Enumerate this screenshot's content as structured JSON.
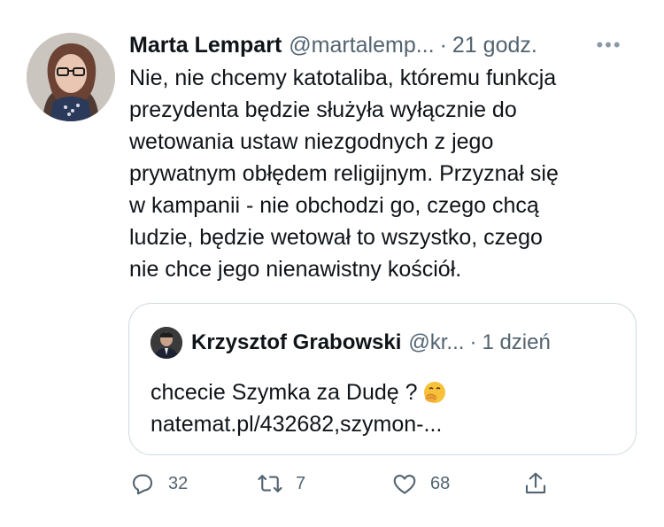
{
  "tweet": {
    "author_name": "Marta Lempart",
    "author_handle": "@martalemp...",
    "separator": "·",
    "time": "21 godz.",
    "more_label": "•••",
    "text": "Nie, nie chcemy katotaliba, któremu funkcja\nprezydenta będzie służyła wyłącznie do\nwetowania ustaw niezgodnych z jego\nprywatnym obłędem religijnym. Przyznał się\nw kampanii - nie obchodzi go, czego chcą\nludzie, będzie wetował to wszystko, czego\nnie chce jego nienawistny kościół."
  },
  "quoted": {
    "author_name": "Krzysztof Grabowski",
    "author_handle": "@kr...",
    "separator": "·",
    "time": "1 dzień",
    "text": "chcecie Szymka za Dudę ?",
    "emoji": "face-with-hand-over-mouth",
    "link": "natemat.pl/432682,szymon-..."
  },
  "actions": {
    "reply_count": "32",
    "retweet_count": "7",
    "like_count": "68"
  },
  "colors": {
    "text": "#0f1419",
    "secondary": "#536471",
    "border": "#cfd9de"
  }
}
